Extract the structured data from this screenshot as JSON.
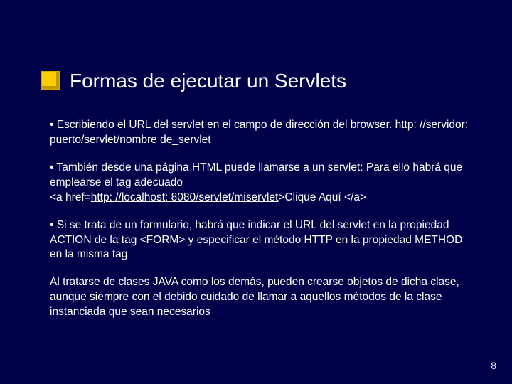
{
  "title": "Formas de ejecutar un Servlets",
  "bullet1_a": "•  Escribiendo el URL del servlet en el campo de dirección del browser.   ",
  "bullet1_link": "http: //servidor: puerto/servlet/nombre",
  "bullet1_b": " de_servlet",
  "bullet2_a": "•  También desde una página HTML puede llamarse a un servlet: Para ello habrá que emplearse el tag adecuado",
  "bullet2_b": "<a href=",
  "bullet2_link": "http: //localhost: 8080/servlet/miservlet",
  "bullet2_c": ">Clique Aquí </a>",
  "bullet3": "• Si se trata de un formulario, habrá que indicar el URL  del servlet en la propiedad ACTION de la tag <FORM> y especificar el método HTTP en la propiedad METHOD en la misma tag",
  "bullet4": "Al tratarse de clases JAVA como los demás, pueden crearse objetos de dicha clase, aunque siempre con el debido cuidado de llamar a aquellos métodos de la clase instanciada que sean necesarios",
  "page_number": "8"
}
